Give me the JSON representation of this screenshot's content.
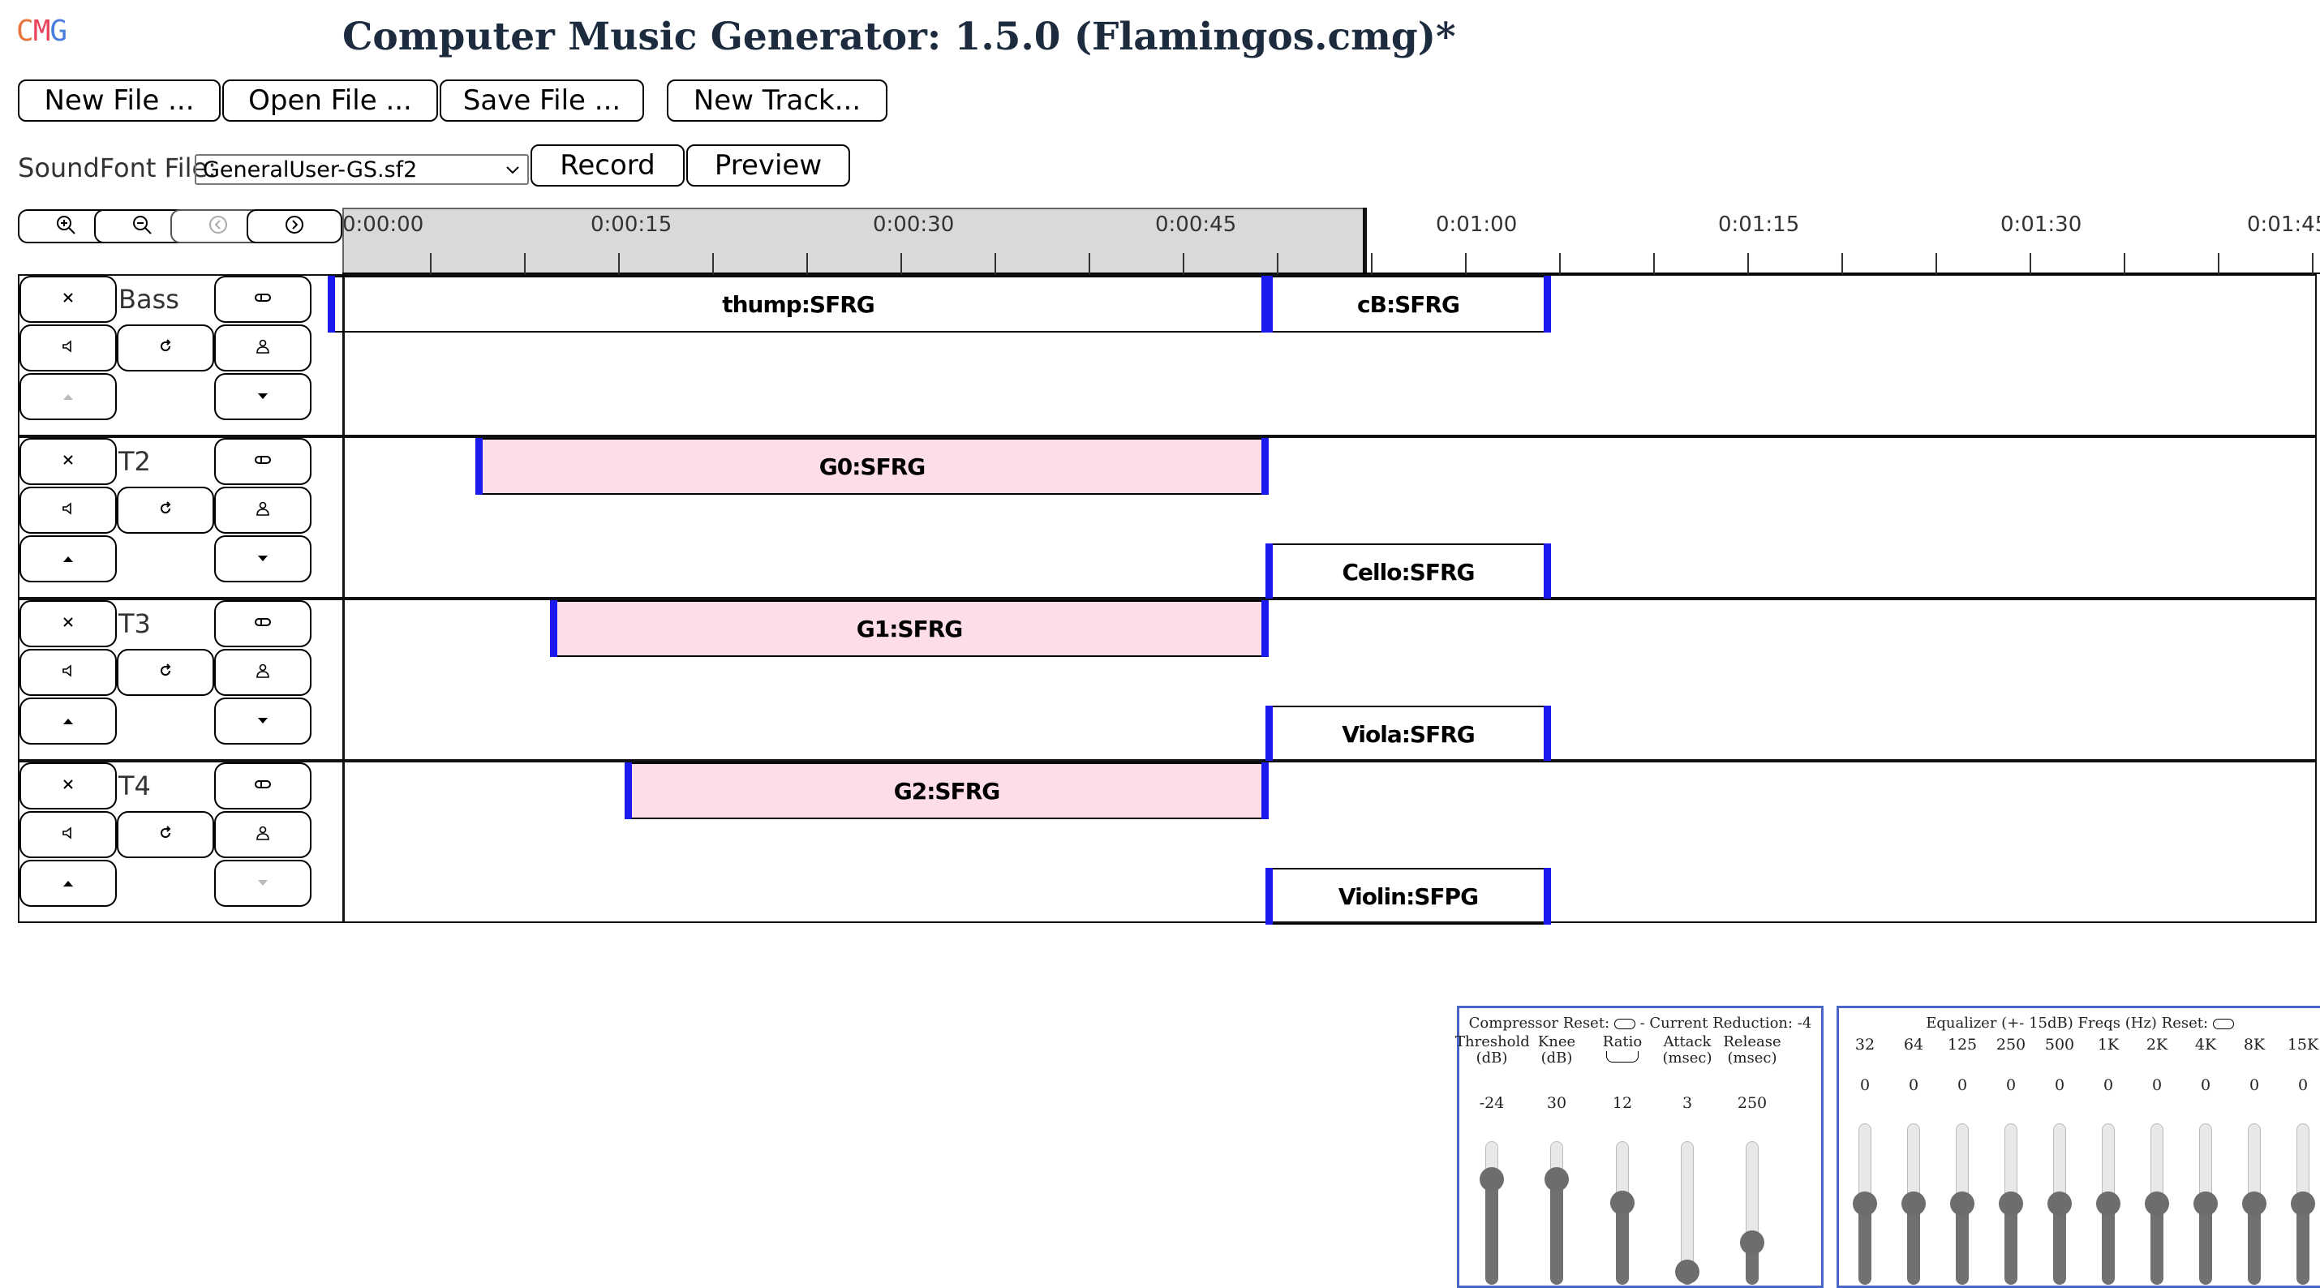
{
  "app": {
    "logo": [
      "C",
      "M",
      "G"
    ],
    "title": "Computer Music Generator: 1.5.0 (Flamingos.cmg)*"
  },
  "toolbar": {
    "new_file": "New File ...",
    "open_file": "Open File ...",
    "save_file": "Save File ...",
    "new_track": "New Track..."
  },
  "soundfont": {
    "label": "SoundFont File:",
    "selected": "GeneralUser-GS.sf2",
    "record": "Record",
    "preview": "Preview"
  },
  "zoom_controls": [
    "zoom-in-icon",
    "zoom-out-icon",
    "scroll-left-icon",
    "scroll-right-icon"
  ],
  "timeline": {
    "labels": [
      "0:00:00",
      "0:00:15",
      "0:00:30",
      "0:00:45",
      "0:01:00",
      "0:01:15",
      "0:01:30",
      "0:01:45"
    ]
  },
  "tracks": [
    {
      "name": "Bass",
      "up_disabled": true,
      "down_disabled": false,
      "clips": [
        {
          "label": "thump:SFRG",
          "lane": 0,
          "style": "plain"
        },
        {
          "label": "cB:SFRG",
          "lane": 0,
          "style": "plain"
        }
      ]
    },
    {
      "name": "T2",
      "up_disabled": false,
      "down_disabled": false,
      "clips": [
        {
          "label": "G0:SFRG",
          "lane": 0,
          "style": "pink"
        },
        {
          "label": "Cello:SFRG",
          "lane": 1,
          "style": "plain"
        }
      ]
    },
    {
      "name": "T3",
      "up_disabled": false,
      "down_disabled": false,
      "clips": [
        {
          "label": "G1:SFRG",
          "lane": 0,
          "style": "pink"
        },
        {
          "label": "Viola:SFRG",
          "lane": 1,
          "style": "plain"
        }
      ]
    },
    {
      "name": "T4",
      "up_disabled": false,
      "down_disabled": true,
      "clips": [
        {
          "label": "G2:SFRG",
          "lane": 0,
          "style": "pink"
        },
        {
          "label": "Violin:SFPG",
          "lane": 1,
          "style": "plain"
        }
      ]
    }
  ],
  "compressor": {
    "title_prefix": "Compressor Reset:",
    "title_suffix": "- Current Reduction: -4",
    "controls": [
      {
        "label": [
          "Threshold",
          "(dB)"
        ],
        "value": "-24",
        "level": 0.78
      },
      {
        "label": [
          "Knee",
          "(dB)"
        ],
        "value": "30",
        "level": 0.78
      },
      {
        "label": [
          "Ratio",
          ""
        ],
        "value": "12",
        "level": 0.58
      },
      {
        "label": [
          "Attack",
          "(msec)"
        ],
        "value": "3",
        "level": 0.0
      },
      {
        "label": [
          "Release",
          "(msec)"
        ],
        "value": "250",
        "level": 0.25
      }
    ]
  },
  "equalizer": {
    "title_prefix": "Equalizer (+- 15dB) Freqs (Hz) Reset:",
    "bands": [
      {
        "freq": "32",
        "value": "0",
        "level": 0.5
      },
      {
        "freq": "64",
        "value": "0",
        "level": 0.5
      },
      {
        "freq": "125",
        "value": "0",
        "level": 0.5
      },
      {
        "freq": "250",
        "value": "0",
        "level": 0.5
      },
      {
        "freq": "500",
        "value": "0",
        "level": 0.5
      },
      {
        "freq": "1K",
        "value": "0",
        "level": 0.5
      },
      {
        "freq": "2K",
        "value": "0",
        "level": 0.5
      },
      {
        "freq": "4K",
        "value": "0",
        "level": 0.5
      },
      {
        "freq": "8K",
        "value": "0",
        "level": 0.5
      },
      {
        "freq": "15K",
        "value": "0",
        "level": 0.5
      }
    ]
  }
}
